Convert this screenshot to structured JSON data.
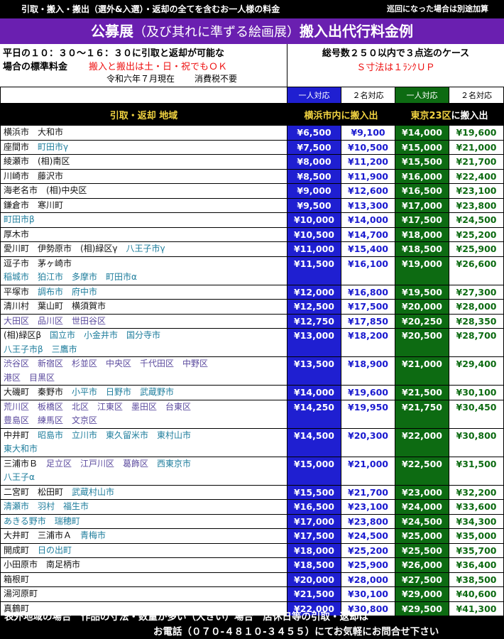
{
  "top_note": {
    "main": "引取・搬入・搬出（選外&入選）・返却の全てを含むお一人様の料金",
    "side": "巡回になった場合は別途加算"
  },
  "title": {
    "main": "公募展",
    "sub": "（及び其れに準ずる絵画展）",
    "tail": "搬入出代行料金例"
  },
  "info": {
    "line1": "平日の１０：３０～１６：３０に引取と返却が可能な",
    "line2": "場合の標準料金",
    "line2_red": "搬入と搬出は土・日・祝でもＯＫ",
    "line3_date": "令和六年７月現在",
    "line3_tax": "消費税不要",
    "right1": "総号数２５０以内で３点迄のケース",
    "right2": "Ｓ寸法は１ﾗﾝｸＵＰ"
  },
  "subhead": [
    "一人対応",
    "２名対応",
    "一人対応",
    "２名対応"
  ],
  "header": {
    "area": "引取・返却 地域",
    "yokohama": "横浜市内に搬入出",
    "tokyo_a": "東京23区",
    "tokyo_b": "に搬入出"
  },
  "colors": {
    "blue": "#1f1fd1",
    "green": "#0d6b12",
    "purple": "#6a1fb0",
    "red": "#e11111"
  },
  "rows": [
    {
      "area": [
        [
          [
            "横浜市　大和市",
            "blk"
          ]
        ]
      ],
      "p": [
        "¥6,500",
        "¥9,100",
        "¥14,000",
        "¥19,600"
      ]
    },
    {
      "area": [
        [
          [
            "座間市　",
            "blk"
          ],
          [
            "町田市γ",
            "col"
          ]
        ]
      ],
      "p": [
        "¥7,500",
        "¥10,500",
        "¥15,000",
        "¥21,000"
      ]
    },
    {
      "area": [
        [
          [
            "綾瀬市　(相)南区",
            "blk"
          ]
        ]
      ],
      "p": [
        "¥8,000",
        "¥11,200",
        "¥15,500",
        "¥21,700"
      ]
    },
    {
      "area": [
        [
          [
            "川崎市　藤沢市",
            "blk"
          ]
        ]
      ],
      "p": [
        "¥8,500",
        "¥11,900",
        "¥16,000",
        "¥22,400"
      ]
    },
    {
      "area": [
        [
          [
            "海老名市　(相)中央区",
            "blk"
          ]
        ]
      ],
      "p": [
        "¥9,000",
        "¥12,600",
        "¥16,500",
        "¥23,100"
      ]
    },
    {
      "area": [
        [
          [
            "鎌倉市　寒川町",
            "blk"
          ]
        ]
      ],
      "p": [
        "¥9,500",
        "¥13,300",
        "¥17,000",
        "¥23,800"
      ]
    },
    {
      "area": [
        [
          [
            "町田市β",
            "col"
          ]
        ]
      ],
      "p": [
        "¥10,000",
        "¥14,000",
        "¥17,500",
        "¥24,500"
      ]
    },
    {
      "area": [
        [
          [
            "厚木市",
            "blk"
          ]
        ]
      ],
      "p": [
        "¥10,500",
        "¥14,700",
        "¥18,000",
        "¥25,200"
      ]
    },
    {
      "area": [
        [
          [
            "愛川町　伊勢原市　(相)緑区γ　",
            "blk"
          ],
          [
            "八王子市γ",
            "col"
          ]
        ]
      ],
      "p": [
        "¥11,000",
        "¥15,400",
        "¥18,500",
        "¥25,900"
      ]
    },
    {
      "area": [
        [
          [
            "逗子市　茅ヶ崎市",
            "blk"
          ]
        ],
        [
          [
            "稲城市　狛江市　多摩市　町田市α",
            "col"
          ]
        ]
      ],
      "p": [
        "¥11,500",
        "¥16,100",
        "¥19,000",
        "¥26,600"
      ]
    },
    {
      "area": [
        [
          [
            "平塚市　",
            "blk"
          ],
          [
            "調布市　府中市",
            "col"
          ]
        ]
      ],
      "p": [
        "¥12,000",
        "¥16,800",
        "¥19,500",
        "¥27,300"
      ]
    },
    {
      "area": [
        [
          [
            "清川村　葉山町　横須賀市",
            "blk"
          ]
        ]
      ],
      "p": [
        "¥12,500",
        "¥17,500",
        "¥20,000",
        "¥28,000"
      ]
    },
    {
      "area": [
        [
          [
            "大田区　品川区　世田谷区",
            "pur"
          ]
        ]
      ],
      "p": [
        "¥12,750",
        "¥17,850",
        "¥20,250",
        "¥28,350"
      ]
    },
    {
      "area": [
        [
          [
            "(相)緑区β　",
            "blk"
          ],
          [
            "国立市　小金井市　国分寺市",
            "col"
          ]
        ],
        [
          [
            "八王子市β　三鷹市",
            "col"
          ]
        ]
      ],
      "p": [
        "¥13,000",
        "¥18,200",
        "¥20,500",
        "¥28,700"
      ]
    },
    {
      "area": [
        [
          [
            "渋谷区　新宿区　杉並区　中央区　千代田区　中野区",
            "pur"
          ]
        ],
        [
          [
            "港区　目黒区",
            "pur"
          ]
        ]
      ],
      "p": [
        "¥13,500",
        "¥18,900",
        "¥21,000",
        "¥29,400"
      ]
    },
    {
      "area": [
        [
          [
            "大磯町　秦野市　",
            "blk"
          ],
          [
            "小平市　日野市　武蔵野市",
            "col"
          ]
        ]
      ],
      "p": [
        "¥14,000",
        "¥19,600",
        "¥21,500",
        "¥30,100"
      ]
    },
    {
      "area": [
        [
          [
            "荒川区　板橋区　北区　江東区　墨田区　台東区",
            "pur"
          ]
        ],
        [
          [
            "豊島区　練馬区　文京区",
            "pur"
          ]
        ]
      ],
      "p": [
        "¥14,250",
        "¥19,950",
        "¥21,750",
        "¥30,450"
      ]
    },
    {
      "area": [
        [
          [
            "中井町　",
            "blk"
          ],
          [
            "昭島市　立川市　東久留米市　東村山市",
            "col"
          ]
        ],
        [
          [
            "東大和市",
            "col"
          ]
        ]
      ],
      "p": [
        "¥14,500",
        "¥20,300",
        "¥22,000",
        "¥30,800"
      ]
    },
    {
      "area": [
        [
          [
            "三浦市Ｂ　",
            "blk"
          ],
          [
            "足立区　江戸川区　葛飾区　",
            "pur"
          ],
          [
            "西東京市",
            "col"
          ]
        ],
        [
          [
            "八王子α",
            "col"
          ]
        ]
      ],
      "p": [
        "¥15,000",
        "¥21,000",
        "¥22,500",
        "¥31,500"
      ]
    },
    {
      "area": [
        [
          [
            "二宮町　松田町　",
            "blk"
          ],
          [
            "武蔵村山市",
            "col"
          ]
        ]
      ],
      "p": [
        "¥15,500",
        "¥21,700",
        "¥23,000",
        "¥32,200"
      ]
    },
    {
      "area": [
        [
          [
            "清瀬市　羽村　福生市",
            "col"
          ]
        ]
      ],
      "p": [
        "¥16,500",
        "¥23,100",
        "¥24,000",
        "¥33,600"
      ]
    },
    {
      "area": [
        [
          [
            "あきる野市　瑞穂町",
            "col"
          ]
        ]
      ],
      "p": [
        "¥17,000",
        "¥23,800",
        "¥24,500",
        "¥34,300"
      ]
    },
    {
      "area": [
        [
          [
            "大井町　三浦市Ａ　",
            "blk"
          ],
          [
            "青梅市",
            "col"
          ]
        ]
      ],
      "p": [
        "¥17,500",
        "¥24,500",
        "¥25,000",
        "¥35,000"
      ]
    },
    {
      "area": [
        [
          [
            "開成町　",
            "blk"
          ],
          [
            "日の出町",
            "col"
          ]
        ]
      ],
      "p": [
        "¥18,000",
        "¥25,200",
        "¥25,500",
        "¥35,700"
      ]
    },
    {
      "area": [
        [
          [
            "小田原市　南足柄市",
            "blk"
          ]
        ]
      ],
      "p": [
        "¥18,500",
        "¥25,900",
        "¥26,000",
        "¥36,400"
      ]
    },
    {
      "area": [
        [
          [
            "箱根町",
            "blk"
          ]
        ]
      ],
      "p": [
        "¥20,000",
        "¥28,000",
        "¥27,500",
        "¥38,500"
      ]
    },
    {
      "area": [
        [
          [
            "湯河原町",
            "blk"
          ]
        ]
      ],
      "p": [
        "¥21,500",
        "¥30,100",
        "¥29,000",
        "¥40,600"
      ]
    },
    {
      "area": [
        [
          [
            "真鶴町",
            "blk"
          ]
        ]
      ],
      "p": [
        "¥22,000",
        "¥30,800",
        "¥29,500",
        "¥41,300"
      ]
    }
  ],
  "footer": {
    "line1": "表外地域の場合　作品の寸法・数量が多い（大きい）場合　店休日等の引取・返却は",
    "line2": "お電話（０７０‐４８１０‐３４５５）にてお気軽にお問合せ下さい"
  }
}
